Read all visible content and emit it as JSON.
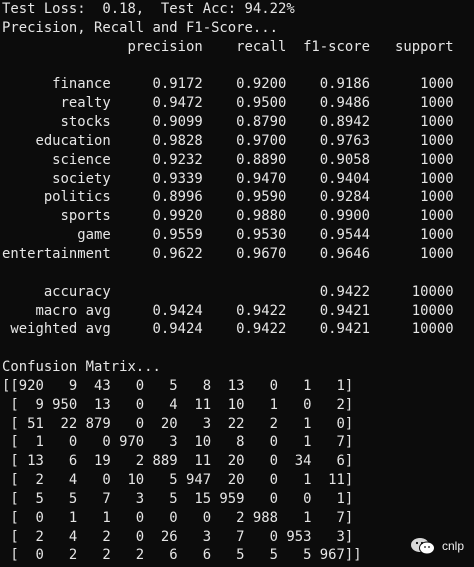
{
  "terminal": {
    "lines": [
      "Test Loss:  0.18,  Test Acc: 94.22%",
      "Precision, Recall and F1-Score...",
      "               precision    recall  f1-score   support",
      "",
      "      finance     0.9172    0.9200    0.9186      1000",
      "       realty     0.9472    0.9500    0.9486      1000",
      "       stocks     0.9099    0.8790    0.8942      1000",
      "    education     0.9828    0.9700    0.9763      1000",
      "      science     0.9232    0.8890    0.9058      1000",
      "      society     0.9339    0.9470    0.9404      1000",
      "     politics     0.8996    0.9590    0.9284      1000",
      "       sports     0.9920    0.9880    0.9900      1000",
      "         game     0.9559    0.9530    0.9544      1000",
      "entertainment     0.9622    0.9670    0.9646      1000",
      "",
      "     accuracy                         0.9422     10000",
      "    macro avg     0.9424    0.9422    0.9421     10000",
      " weighted avg     0.9424    0.9422    0.9421     10000",
      "",
      "Confusion Matrix...",
      "[[920   9  43   0   5   8  13   0   1   1]",
      " [  9 950  13   0   4  11  10   1   0   2]",
      " [ 51  22 879   0  20   3  22   2   1   0]",
      " [  1   0   0 970   3  10   8   0   1   7]",
      " [ 13   6  19   2 889  11  20   0  34   6]",
      " [  2   4   0  10   5 947  20   0   1  11]",
      " [  5   5   7   3   5  15 959   0   0   1]",
      " [  0   1   1   0   0   0   2 988   1   7]",
      " [  2   4   2   0  26   3   7   0 953   3]",
      " [  0   2   2   2   6   6   5   5   5 967]]"
    ]
  },
  "watermark": {
    "text": "cnlp",
    "icon": "wechat-icon"
  }
}
